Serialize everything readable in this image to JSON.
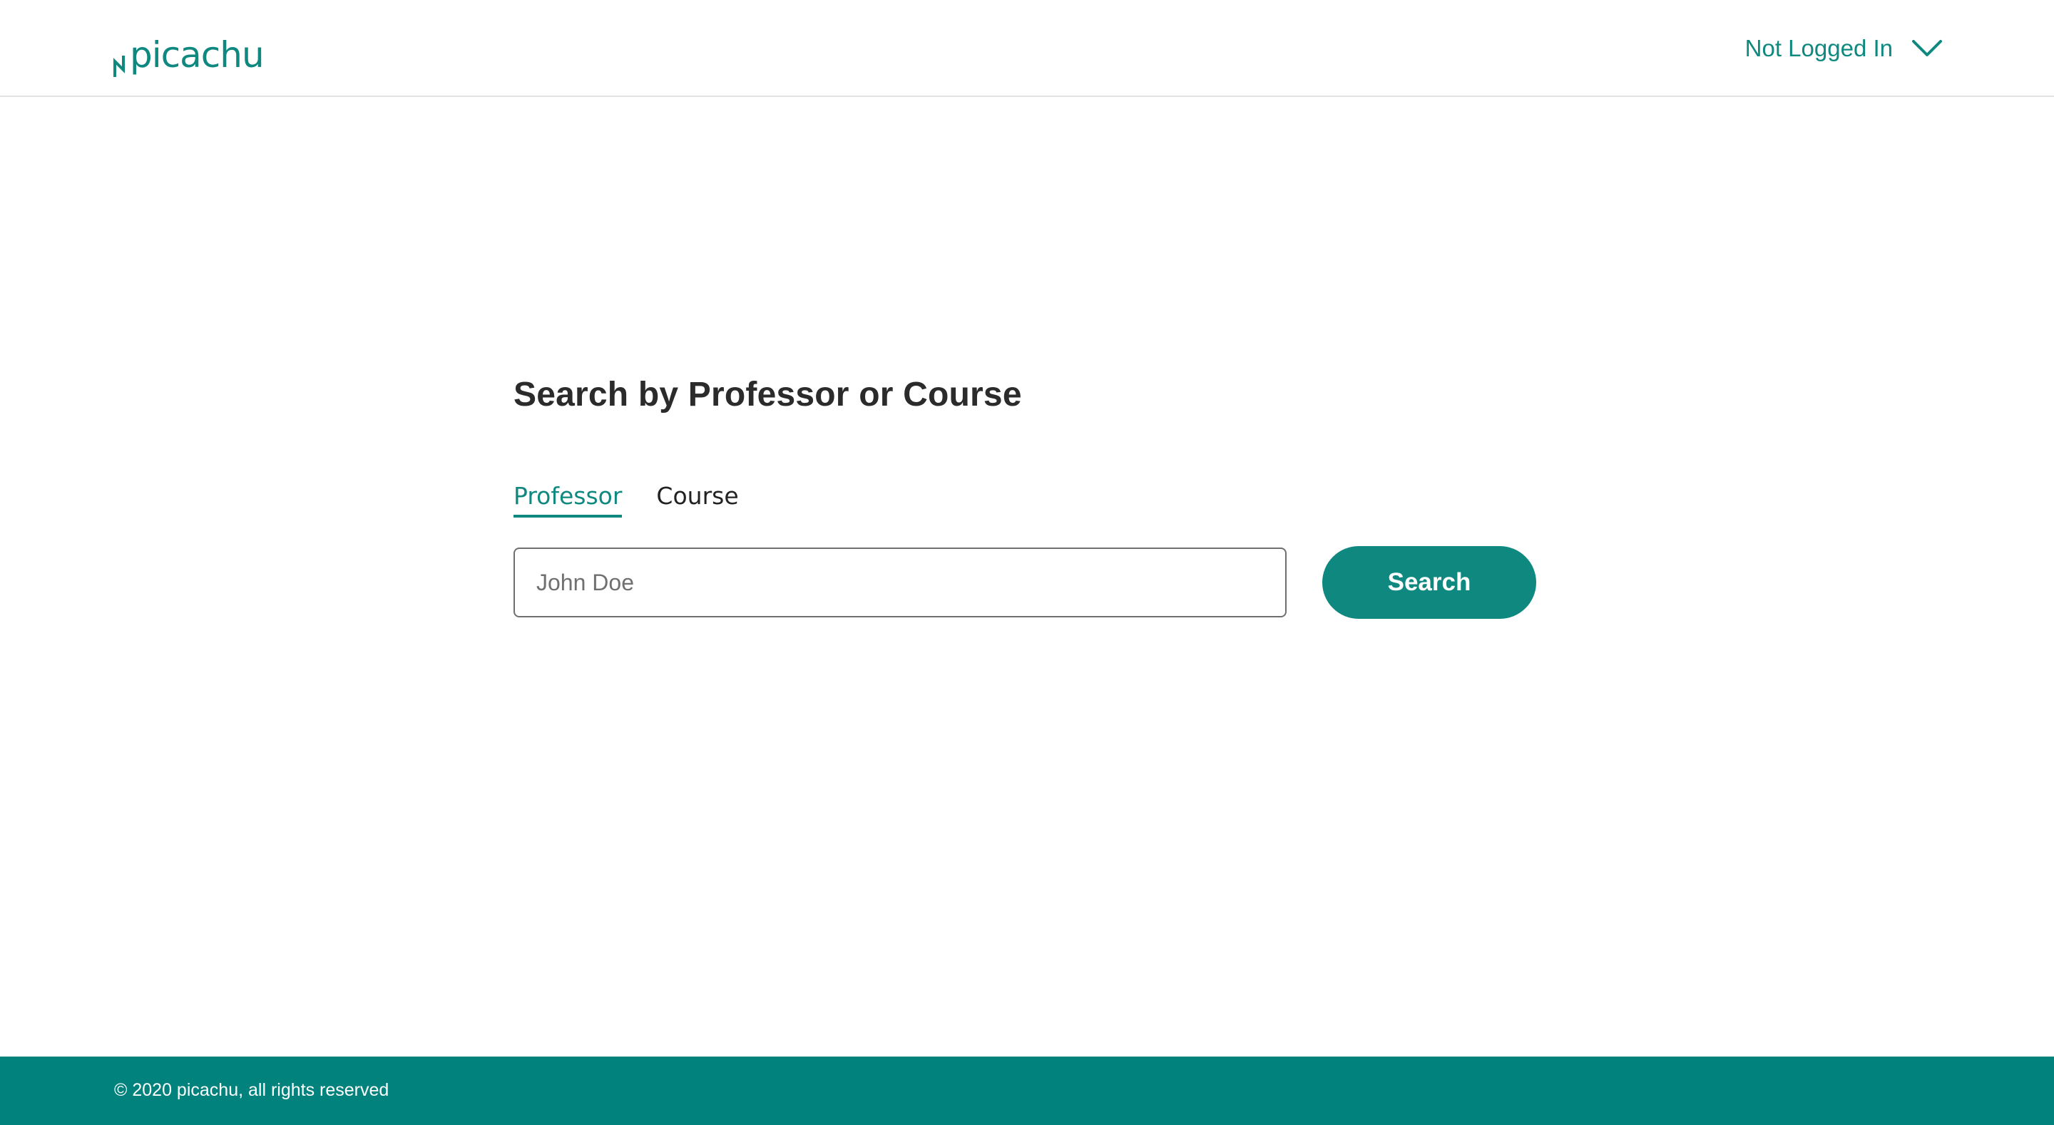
{
  "header": {
    "logo_text": "picachu",
    "account_label": "Not Logged In",
    "account_icon": "chevron-down-icon"
  },
  "main": {
    "title": "Search by Professor or Course",
    "tabs": [
      {
        "label": "Professor",
        "active": true
      },
      {
        "label": "Course",
        "active": false
      }
    ],
    "search": {
      "placeholder": "John Doe",
      "value": "",
      "button_label": "Search"
    }
  },
  "footer": {
    "text": "© 2020 picachu, all rights reserved"
  },
  "colors": {
    "brand": "#0f8980",
    "footer_bg": "#01827c",
    "text_dark": "#2b2b2b",
    "input_border": "#6f6f6f"
  }
}
